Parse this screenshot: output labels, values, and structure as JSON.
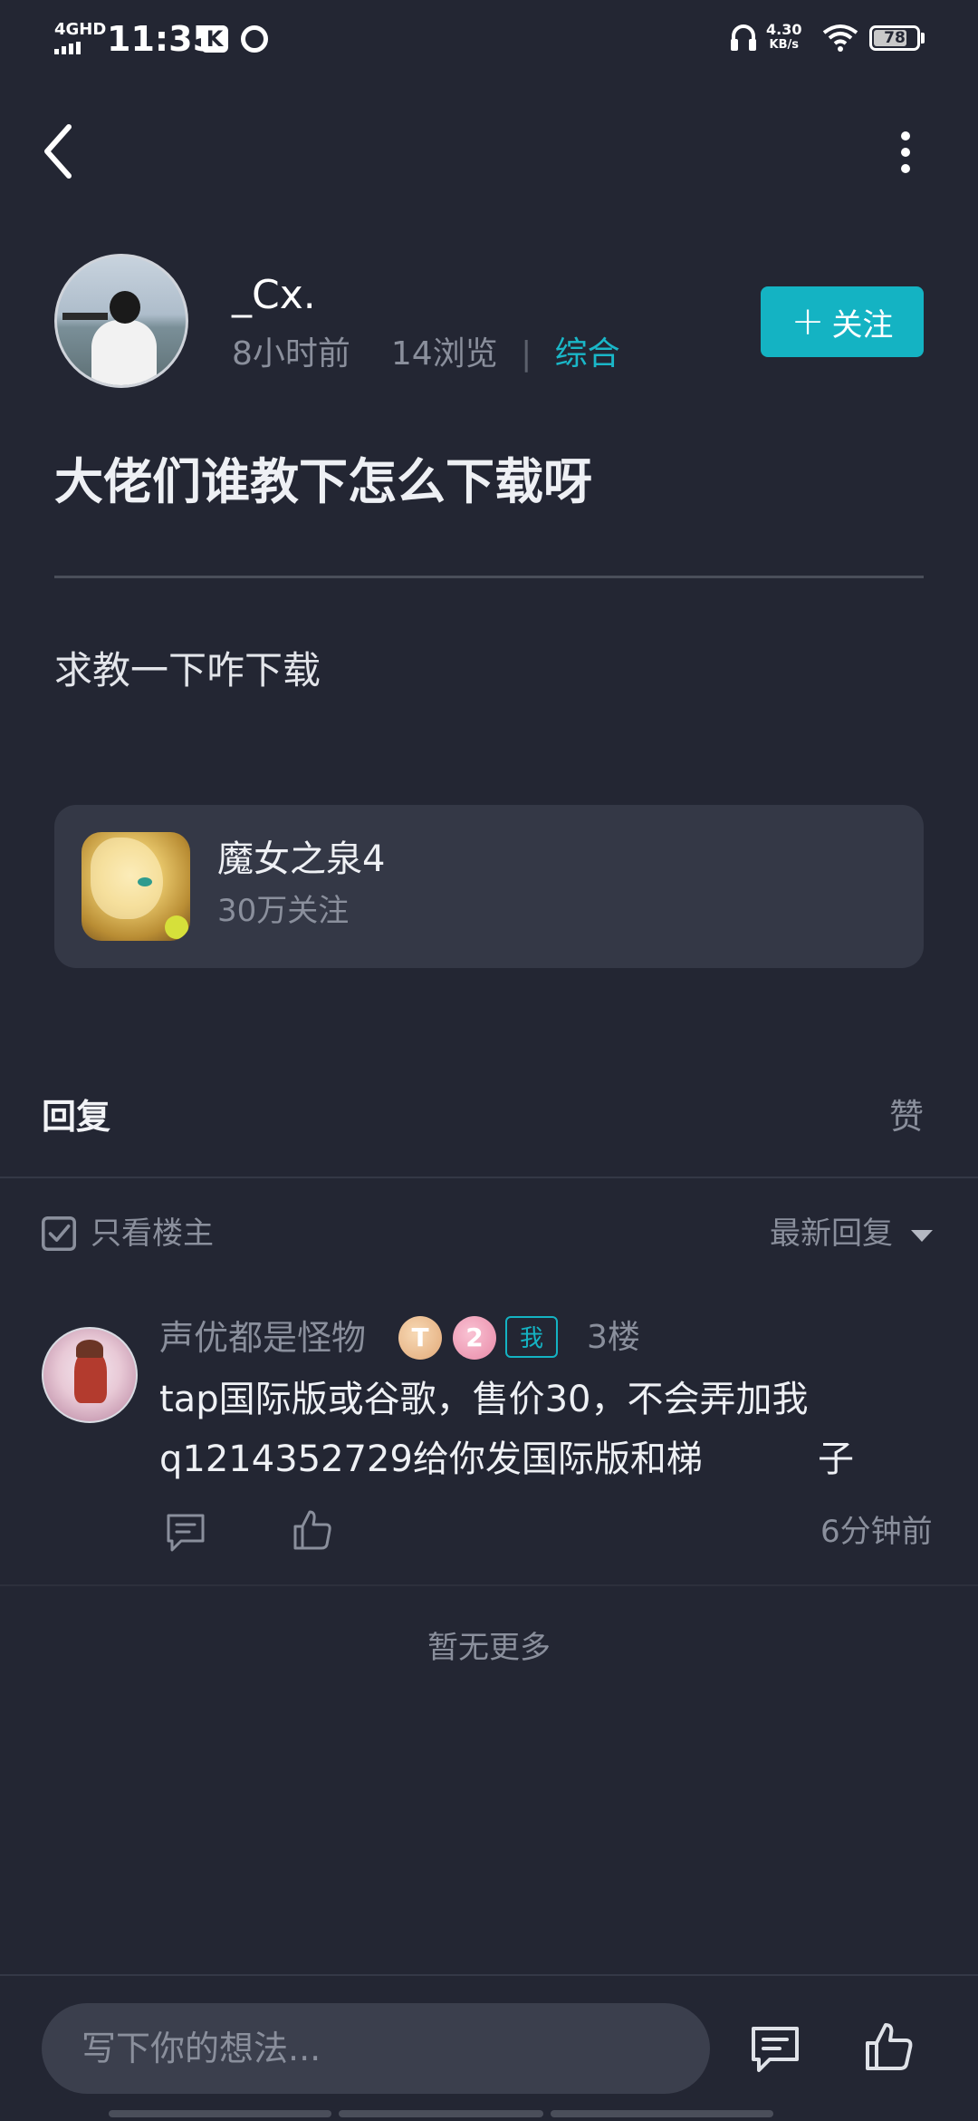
{
  "status_bar": {
    "network": "4GHD",
    "time": "11:35",
    "app_icon_1": "K",
    "speed_value": "4.30",
    "speed_unit": "KB/s",
    "battery": "78",
    "battery_level": 0.78,
    "icons": [
      "signal-icon",
      "k-app-icon",
      "q-app-icon",
      "headphones-icon",
      "wifi-icon",
      "battery-icon"
    ]
  },
  "nav": {
    "back_icon": "back-icon",
    "more_icon": "more-icon"
  },
  "author": {
    "name": "_Cx.",
    "time_ago": "8小时前",
    "views": "14浏览",
    "separator": "|",
    "category": "综合",
    "follow_label": "关注",
    "follow_plus": "+"
  },
  "post": {
    "title": "大佬们谁教下怎么下载呀",
    "body": "求教一下咋下载"
  },
  "game_card": {
    "name": "魔女之泉4",
    "followers": "30万关注"
  },
  "replies_header": {
    "reply_tab": "回复",
    "like_tab": "赞",
    "only_op_label": "只看楼主",
    "only_op_checked": true,
    "sort_label": "最新回复"
  },
  "comments": [
    {
      "user": "声优都是怪物",
      "badge_ts": "T",
      "badge_level": "2",
      "badge_me": "我",
      "floor": "3楼",
      "text_line_1": "tap国际版或谷歌，售价30，不会弄加我",
      "text_line_2": "q1214352729给你发国际版和梯          子",
      "time": "6分钟前"
    }
  ],
  "footer_note": "暂无更多",
  "bottom_bar": {
    "input_placeholder": "写下你的想法..."
  },
  "colors": {
    "background": "#232633",
    "accent": "#14b3c3",
    "card": "#343846",
    "muted_text": "#8a8f9c"
  }
}
